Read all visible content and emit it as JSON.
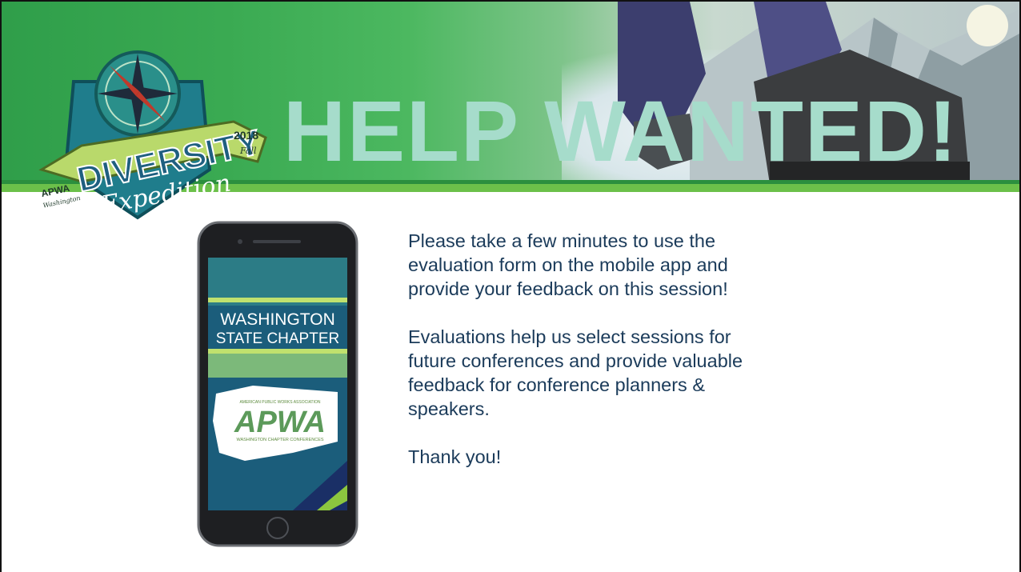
{
  "banner": {
    "headline": "HELP WANTED!",
    "logo": {
      "badge_text": "DIVERSITY",
      "script_text": "Expedition",
      "year": "2018",
      "season": "Fall",
      "org": "APWA",
      "state": "Washington"
    }
  },
  "phone_screen": {
    "line1": "WASHINGTON",
    "line2": "STATE CHAPTER",
    "assoc": "AMERICAN PUBLIC WORKS ASSOCIATION",
    "acronym": "APWA",
    "subtitle": "WASHINGTON CHAPTER CONFERENCES"
  },
  "body": {
    "para1": "Please take a few minutes to use the evaluation form on the mobile app and provide your feedback on this session!",
    "para2": "Evaluations help us select sessions for future conferences and provide valuable feedback for conference planners & speakers.",
    "para3": "Thank you!"
  },
  "colors": {
    "headline": "#a6dccb",
    "text": "#1b3b5a",
    "banner_green": "#3aaa52",
    "stripe": "#6cc04a"
  }
}
